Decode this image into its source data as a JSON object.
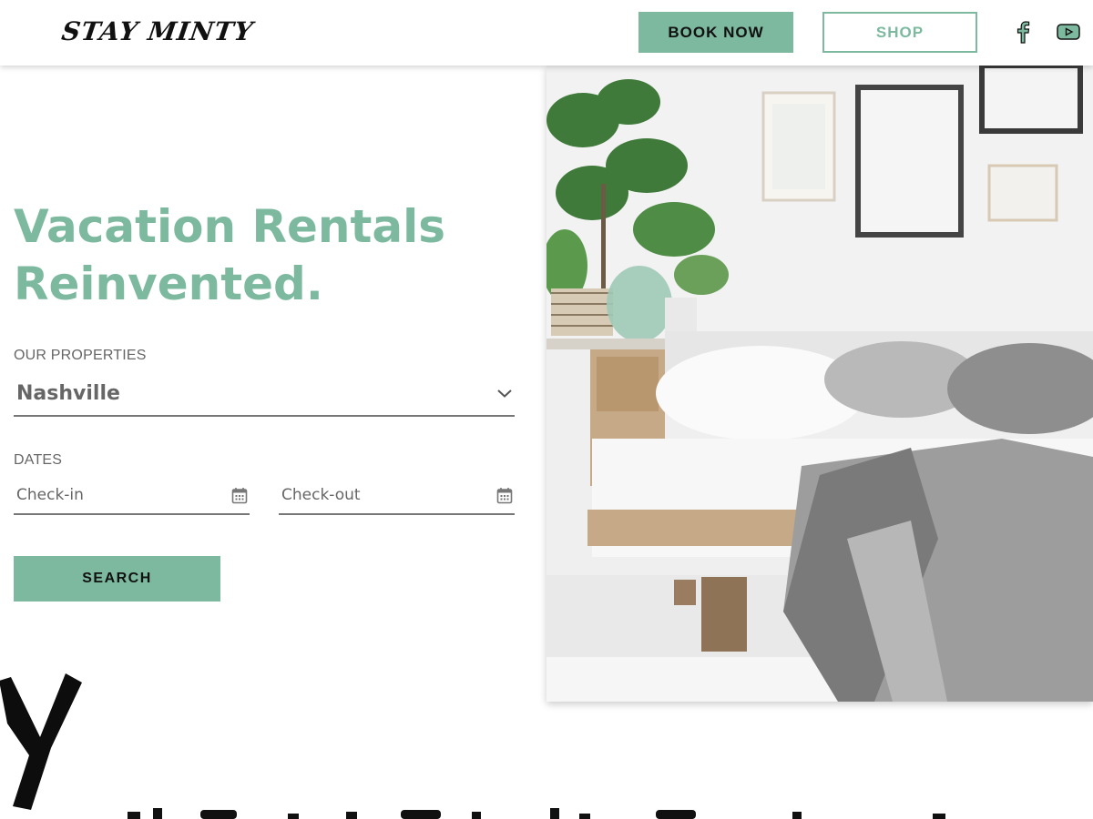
{
  "header": {
    "logo_text": "STAY MINTY",
    "book_label": "BOOK NOW",
    "shop_label": "SHOP",
    "social": [
      "facebook-icon",
      "youtube-icon"
    ]
  },
  "hero": {
    "headline_line1": "Vacation Rentals",
    "headline_line2": "Reinvented.",
    "properties_label": "OUR PROPERTIES",
    "property_selected": "Nashville",
    "dates_label": "DATES",
    "checkin_placeholder": "Check-in",
    "checkout_placeholder": "Check-out",
    "search_label": "SEARCH"
  },
  "colors": {
    "accent": "#7cb99f",
    "text_dark": "#111111",
    "text_muted": "#666666"
  }
}
